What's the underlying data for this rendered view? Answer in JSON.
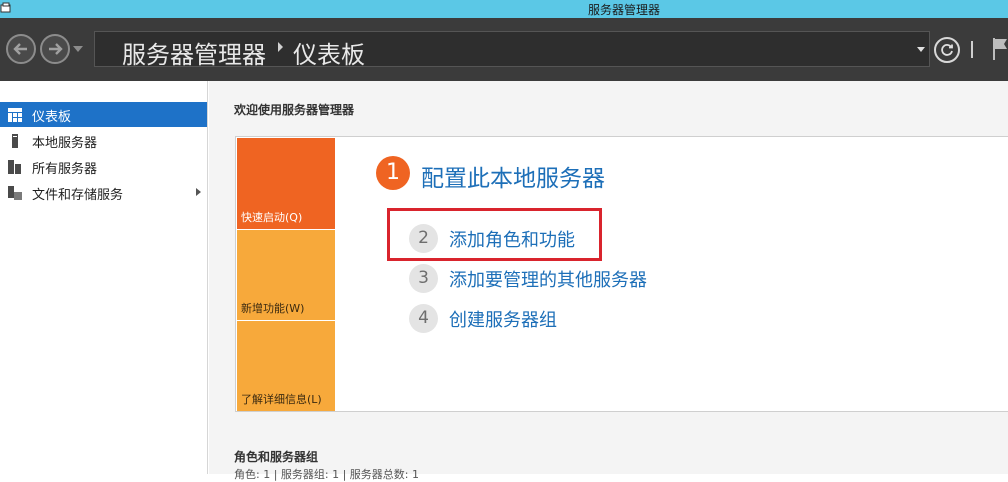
{
  "window": {
    "title": "服务器管理器"
  },
  "nav": {
    "breadcrumb_root": "服务器管理器",
    "breadcrumb_current": "仪表板"
  },
  "sidebar": {
    "items": [
      {
        "label": "仪表板",
        "icon": "dashboard-icon",
        "active": true
      },
      {
        "label": "本地服务器",
        "icon": "server-icon"
      },
      {
        "label": "所有服务器",
        "icon": "servers-icon"
      },
      {
        "label": "文件和存储服务",
        "icon": "storage-icon",
        "expandable": true
      }
    ]
  },
  "main": {
    "welcome": "欢迎使用服务器管理器",
    "tiles": [
      {
        "label": "快速启动(Q)"
      },
      {
        "label": "新增功能(W)"
      },
      {
        "label": "了解详细信息(L)"
      }
    ],
    "steps": [
      {
        "num": "1",
        "label": "配置此本地服务器"
      },
      {
        "num": "2",
        "label": "添加角色和功能"
      },
      {
        "num": "3",
        "label": "添加要管理的其他服务器"
      },
      {
        "num": "4",
        "label": "创建服务器组"
      }
    ],
    "roles_title": "角色和服务器组",
    "roles_summary": "角色: 1 | 服务器组: 1 | 服务器总数: 1"
  },
  "colors": {
    "titlebar": "#5bc8e6",
    "navbar": "#3b3b3b",
    "accent_orange": "#ef6422",
    "tile_light_orange": "#f7a93b",
    "link_blue": "#1d6fb8",
    "sidebar_active": "#1e72c8",
    "highlight_red": "#d9242d"
  }
}
